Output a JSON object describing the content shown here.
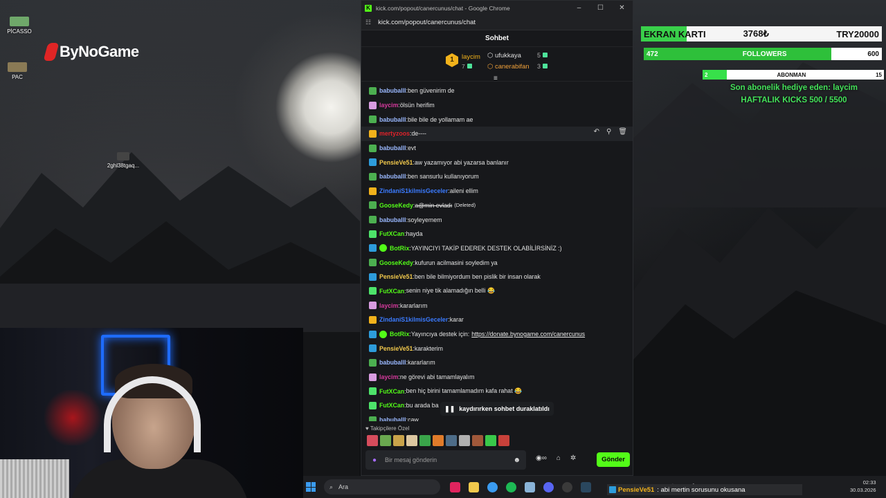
{
  "desktop": {
    "icons": [
      {
        "label": "PİCASSO"
      },
      {
        "label": "PAC"
      },
      {
        "label": "2ghl38tgaq..."
      }
    ],
    "logo": "ByNoGame"
  },
  "window": {
    "title": "kick.com/popout/canercunus/chat - Google Chrome",
    "url": "kick.com/popout/canercunus/chat",
    "controls": [
      "–",
      "☐",
      "✕"
    ]
  },
  "chat": {
    "header": "Sohbet",
    "leaderboard": {
      "first": {
        "rank": "1",
        "name": "laycim",
        "count": "7"
      },
      "second": {
        "name": "ufukkaya",
        "count": "5"
      },
      "third": {
        "name": "canerabifan",
        "count": "3"
      }
    },
    "messages": [
      {
        "user": "babuballl",
        "text": "ben güvenirim de",
        "color": "#9ab8ff",
        "badge": "#4caf50"
      },
      {
        "user": "laycim",
        "text": "ölsün herifim",
        "color": "#d63a9d",
        "badge": "#d89ce0"
      },
      {
        "user": "babuballl",
        "text": "bile bile de yollamam ae",
        "color": "#9ab8ff",
        "badge": "#4caf50"
      },
      {
        "user": "mertyzoos",
        "text": "de----",
        "color": "#e0222a",
        "badge": "#f2b21b",
        "hover": true
      },
      {
        "user": "babuballl",
        "text": "evt",
        "color": "#9ab8ff",
        "badge": "#4caf50"
      },
      {
        "user": "PensieVe51",
        "text": "aw yazamıyor abi yazarsa banlanır",
        "color": "#f2c94c",
        "badge": "#2d9cdb"
      },
      {
        "user": "babuballl",
        "text": "ben sansurlu kullanıyorum",
        "color": "#9ab8ff",
        "badge": "#4caf50"
      },
      {
        "user": "ZindaniS1kilmisGeceler",
        "text": "aileni ellim",
        "color": "#3b7bff",
        "badge": "#f2b21b"
      },
      {
        "user": "GooseKedy",
        "text": "a@min evladı",
        "color": "#53fc18",
        "badge": "#4caf50",
        "deleted": true,
        "deleted_label": "(Deleted)"
      },
      {
        "user": "babuballl",
        "text": "soyleyemem",
        "color": "#9ab8ff",
        "badge": "#4caf50"
      },
      {
        "user": "FutXCan",
        "text": "hayda",
        "color": "#53fc18",
        "badge": "#4de36a"
      },
      {
        "user": "BotRix",
        "text": "YAYINCIYI TAKİP EDEREK DESTEK OLABİLİRSİNİZ :)",
        "color": "#53fc18",
        "badge": "#2d9cdb",
        "bot": true
      },
      {
        "user": "GooseKedy",
        "text": "kufurun acilmasini soyledim ya",
        "color": "#53fc18",
        "badge": "#4caf50"
      },
      {
        "user": "PensieVe51",
        "text": "ben bile bilmiyordum ben pislik bir insan olarak",
        "color": "#f2c94c",
        "badge": "#2d9cdb"
      },
      {
        "user": "FutXCan",
        "text": "senin niye tik alamadığın belli 😂",
        "color": "#53fc18",
        "badge": "#4de36a"
      },
      {
        "user": "laycim",
        "text": "kararlarım",
        "color": "#d63a9d",
        "badge": "#d89ce0"
      },
      {
        "user": "ZindaniS1kilmisGeceler",
        "text": "karar",
        "color": "#3b7bff",
        "badge": "#f2b21b"
      },
      {
        "user": "BotRix",
        "text": "Yayıncıya destek için:",
        "link": "https://donate.bynogame.com/canercunus",
        "color": "#53fc18",
        "badge": "#2d9cdb",
        "bot": true
      },
      {
        "user": "PensieVe51",
        "text": "karakterim",
        "color": "#f2c94c",
        "badge": "#2d9cdb"
      },
      {
        "user": "babuballl",
        "text": "kararlarım",
        "color": "#9ab8ff",
        "badge": "#4caf50"
      },
      {
        "user": "laycim",
        "text": "ne görevi abi tamamlayalım",
        "color": "#d63a9d",
        "badge": "#d89ce0"
      },
      {
        "user": "FutXCan",
        "text": "ben hiç birini tamamlamadım kafa rahat 😂",
        "color": "#53fc18",
        "badge": "#4de36a"
      },
      {
        "user": "FutXCan",
        "text": "bu arada ba",
        "color": "#53fc18",
        "badge": "#4de36a"
      },
      {
        "user": "babuballl",
        "text": "caw",
        "color": "#9ab8ff",
        "badge": "#4caf50"
      }
    ],
    "paused_notice": "kaydırırken sohbet duraklatıldı",
    "emotes_label": "Takipçilere Özel",
    "input_placeholder": "Bir mesaj gönderin",
    "send_label": "Gönder"
  },
  "overlay": {
    "ekran": {
      "label": "EKRAN KARTI",
      "current": "3768₺",
      "goal": "TRY20000",
      "progress": 0.19
    },
    "followers": {
      "current": "472",
      "label": "FOLLOWERS",
      "goal": "600",
      "progress": 0.787
    },
    "abonman": {
      "current": "2",
      "label": "ABONMAN",
      "goal": "15",
      "progress": 0.133
    },
    "last_gift": "Son abonelik hediye eden: laycim",
    "weekly_kicks": "HAFTALIK KICKS 500 / 5500"
  },
  "taskbar": {
    "search_placeholder": "Ara",
    "ticker_user": "PensieVe51",
    "ticker_text": ": abi mertin sorusunu okusana",
    "time": "02:33",
    "date": "30.03.2026"
  }
}
